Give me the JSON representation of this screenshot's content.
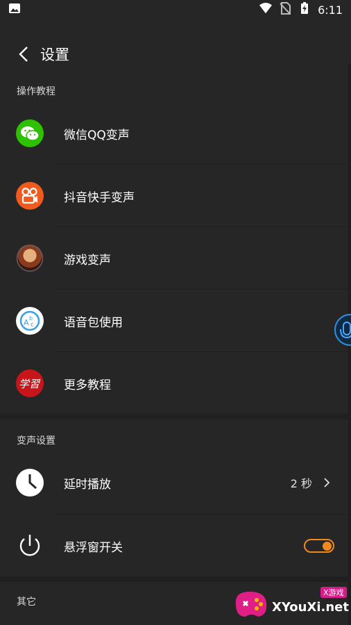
{
  "status_bar": {
    "time": "6:11"
  },
  "header": {
    "title": "设置"
  },
  "sections": {
    "tutorials": {
      "label": "操作教程",
      "items": [
        {
          "label": "微信QQ变声",
          "icon": "wechat-icon"
        },
        {
          "label": "抖音快手变声",
          "icon": "kuaishou-icon"
        },
        {
          "label": "游戏变声",
          "icon": "game-avatar-icon"
        },
        {
          "label": "语音包使用",
          "icon": "abc-voice-pack-icon"
        },
        {
          "label": "更多教程",
          "icon": "study-icon"
        }
      ]
    },
    "voice_settings": {
      "label": "变声设置",
      "delay": {
        "label": "延时播放",
        "value": "2 秒"
      },
      "float_window": {
        "label": "悬浮窗开关",
        "enabled": true
      }
    },
    "other": {
      "label": "其它"
    }
  },
  "study_icon_text": "学習",
  "watermark": {
    "text": "XYouXi.net",
    "badge": "X游戏"
  },
  "colors": {
    "background": "#262626",
    "accent": "#f08a1c",
    "wechat_green": "#2dc100",
    "kuaishou_orange": "#f05a1e",
    "study_red": "#c8151b"
  }
}
